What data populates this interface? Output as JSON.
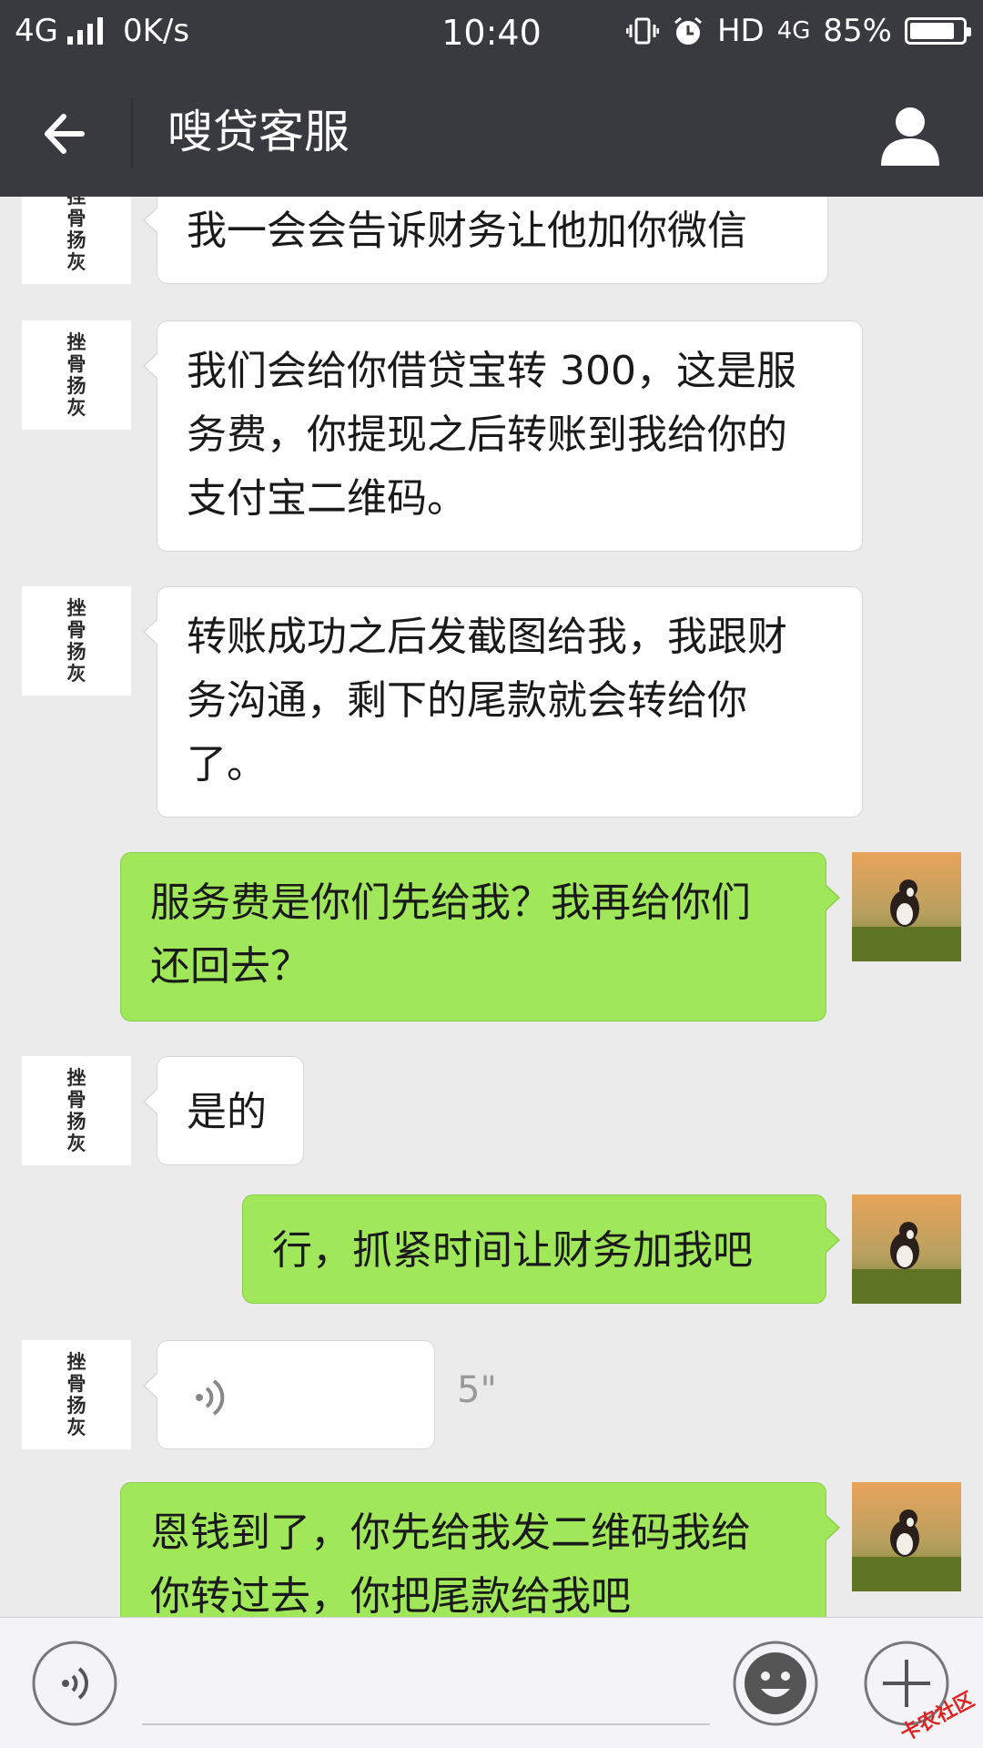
{
  "status_bar": {
    "network": "4G",
    "speed": "0K/s",
    "time": "10:40",
    "hd": "HD",
    "network2": "4G",
    "battery_text": "85%",
    "battery_level": 0.85
  },
  "header": {
    "title": "嗖贷客服"
  },
  "contact": {
    "avatar_text": [
      "挫",
      "骨",
      "扬",
      "灰"
    ]
  },
  "messages": [
    {
      "from": "them",
      "text": "我一会会告诉财务让他加你微信"
    },
    {
      "from": "them",
      "lines": [
        "我们会给你借贷宝转 300，这是服",
        "务费，你提现之后转账到我给你的",
        "支付宝二维码。"
      ]
    },
    {
      "from": "them",
      "lines": [
        "转账成功之后发截图给我，我跟财",
        "务沟通，剩下的尾款就会转给你",
        "了。"
      ]
    },
    {
      "from": "me",
      "lines": [
        "服务费是你们先给我？我再给你们",
        "还回去？"
      ]
    },
    {
      "from": "them",
      "text": "是的"
    },
    {
      "from": "me",
      "text": "行，抓紧时间让财务加我吧"
    },
    {
      "from": "them",
      "type": "voice",
      "duration": "5\""
    },
    {
      "from": "me",
      "lines": [
        "恩钱到了，你先给我发二维码我给",
        "你转过去，你把尾款给我吧"
      ]
    }
  ],
  "watermark": "卡农社区",
  "colors": {
    "header_bg": "#393a3f",
    "chat_bg": "#ebebeb",
    "bubble_in": "#ffffff",
    "bubble_out": "#a0e75a"
  },
  "icons": {
    "back": "arrow-left-icon",
    "profile": "person-icon",
    "voice": "voice-wave-icon",
    "emoji": "smiley-icon",
    "more": "plus-icon"
  }
}
